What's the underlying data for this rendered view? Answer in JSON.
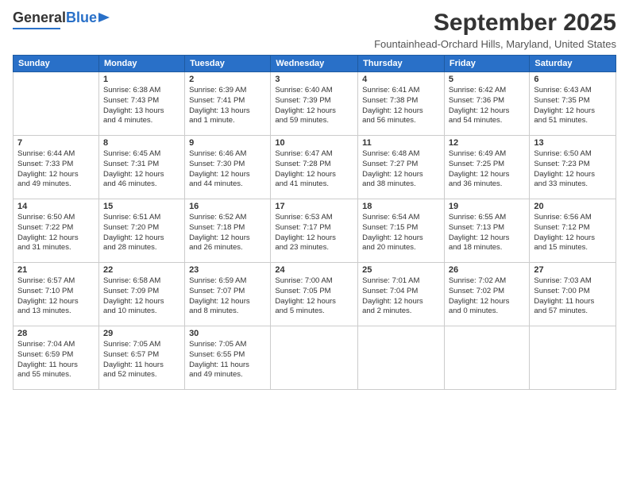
{
  "header": {
    "logo_general": "General",
    "logo_blue": "Blue",
    "month_title": "September 2025",
    "subtitle": "Fountainhead-Orchard Hills, Maryland, United States"
  },
  "weekdays": [
    "Sunday",
    "Monday",
    "Tuesday",
    "Wednesday",
    "Thursday",
    "Friday",
    "Saturday"
  ],
  "weeks": [
    [
      {
        "day": "",
        "info": ""
      },
      {
        "day": "1",
        "info": "Sunrise: 6:38 AM\nSunset: 7:43 PM\nDaylight: 13 hours\nand 4 minutes."
      },
      {
        "day": "2",
        "info": "Sunrise: 6:39 AM\nSunset: 7:41 PM\nDaylight: 13 hours\nand 1 minute."
      },
      {
        "day": "3",
        "info": "Sunrise: 6:40 AM\nSunset: 7:39 PM\nDaylight: 12 hours\nand 59 minutes."
      },
      {
        "day": "4",
        "info": "Sunrise: 6:41 AM\nSunset: 7:38 PM\nDaylight: 12 hours\nand 56 minutes."
      },
      {
        "day": "5",
        "info": "Sunrise: 6:42 AM\nSunset: 7:36 PM\nDaylight: 12 hours\nand 54 minutes."
      },
      {
        "day": "6",
        "info": "Sunrise: 6:43 AM\nSunset: 7:35 PM\nDaylight: 12 hours\nand 51 minutes."
      }
    ],
    [
      {
        "day": "7",
        "info": "Sunrise: 6:44 AM\nSunset: 7:33 PM\nDaylight: 12 hours\nand 49 minutes."
      },
      {
        "day": "8",
        "info": "Sunrise: 6:45 AM\nSunset: 7:31 PM\nDaylight: 12 hours\nand 46 minutes."
      },
      {
        "day": "9",
        "info": "Sunrise: 6:46 AM\nSunset: 7:30 PM\nDaylight: 12 hours\nand 44 minutes."
      },
      {
        "day": "10",
        "info": "Sunrise: 6:47 AM\nSunset: 7:28 PM\nDaylight: 12 hours\nand 41 minutes."
      },
      {
        "day": "11",
        "info": "Sunrise: 6:48 AM\nSunset: 7:27 PM\nDaylight: 12 hours\nand 38 minutes."
      },
      {
        "day": "12",
        "info": "Sunrise: 6:49 AM\nSunset: 7:25 PM\nDaylight: 12 hours\nand 36 minutes."
      },
      {
        "day": "13",
        "info": "Sunrise: 6:50 AM\nSunset: 7:23 PM\nDaylight: 12 hours\nand 33 minutes."
      }
    ],
    [
      {
        "day": "14",
        "info": "Sunrise: 6:50 AM\nSunset: 7:22 PM\nDaylight: 12 hours\nand 31 minutes."
      },
      {
        "day": "15",
        "info": "Sunrise: 6:51 AM\nSunset: 7:20 PM\nDaylight: 12 hours\nand 28 minutes."
      },
      {
        "day": "16",
        "info": "Sunrise: 6:52 AM\nSunset: 7:18 PM\nDaylight: 12 hours\nand 26 minutes."
      },
      {
        "day": "17",
        "info": "Sunrise: 6:53 AM\nSunset: 7:17 PM\nDaylight: 12 hours\nand 23 minutes."
      },
      {
        "day": "18",
        "info": "Sunrise: 6:54 AM\nSunset: 7:15 PM\nDaylight: 12 hours\nand 20 minutes."
      },
      {
        "day": "19",
        "info": "Sunrise: 6:55 AM\nSunset: 7:13 PM\nDaylight: 12 hours\nand 18 minutes."
      },
      {
        "day": "20",
        "info": "Sunrise: 6:56 AM\nSunset: 7:12 PM\nDaylight: 12 hours\nand 15 minutes."
      }
    ],
    [
      {
        "day": "21",
        "info": "Sunrise: 6:57 AM\nSunset: 7:10 PM\nDaylight: 12 hours\nand 13 minutes."
      },
      {
        "day": "22",
        "info": "Sunrise: 6:58 AM\nSunset: 7:09 PM\nDaylight: 12 hours\nand 10 minutes."
      },
      {
        "day": "23",
        "info": "Sunrise: 6:59 AM\nSunset: 7:07 PM\nDaylight: 12 hours\nand 8 minutes."
      },
      {
        "day": "24",
        "info": "Sunrise: 7:00 AM\nSunset: 7:05 PM\nDaylight: 12 hours\nand 5 minutes."
      },
      {
        "day": "25",
        "info": "Sunrise: 7:01 AM\nSunset: 7:04 PM\nDaylight: 12 hours\nand 2 minutes."
      },
      {
        "day": "26",
        "info": "Sunrise: 7:02 AM\nSunset: 7:02 PM\nDaylight: 12 hours\nand 0 minutes."
      },
      {
        "day": "27",
        "info": "Sunrise: 7:03 AM\nSunset: 7:00 PM\nDaylight: 11 hours\nand 57 minutes."
      }
    ],
    [
      {
        "day": "28",
        "info": "Sunrise: 7:04 AM\nSunset: 6:59 PM\nDaylight: 11 hours\nand 55 minutes."
      },
      {
        "day": "29",
        "info": "Sunrise: 7:05 AM\nSunset: 6:57 PM\nDaylight: 11 hours\nand 52 minutes."
      },
      {
        "day": "30",
        "info": "Sunrise: 7:05 AM\nSunset: 6:55 PM\nDaylight: 11 hours\nand 49 minutes."
      },
      {
        "day": "",
        "info": ""
      },
      {
        "day": "",
        "info": ""
      },
      {
        "day": "",
        "info": ""
      },
      {
        "day": "",
        "info": ""
      }
    ]
  ]
}
